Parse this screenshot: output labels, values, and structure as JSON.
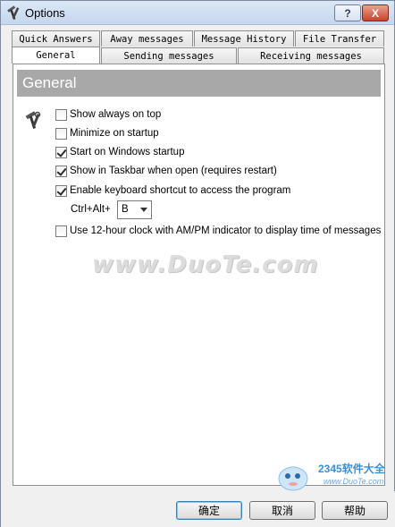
{
  "window": {
    "title": "Options"
  },
  "title_buttons": {
    "help": "?",
    "close": "X"
  },
  "tabs_row1": [
    "Quick Answers",
    "Away messages",
    "Message History",
    "File Transfer"
  ],
  "tabs_row2": [
    "General",
    "Sending messages",
    "Receiving messages"
  ],
  "active_tab": "General",
  "section": {
    "title": "General"
  },
  "options": [
    {
      "label": "Show always on top",
      "checked": false
    },
    {
      "label": "Minimize on startup",
      "checked": false
    },
    {
      "label": "Start on Windows startup",
      "checked": true
    },
    {
      "label": "Show in Taskbar when open (requires restart)",
      "checked": true
    },
    {
      "label": "Enable keyboard shortcut to access the program",
      "checked": true
    }
  ],
  "shortcut": {
    "label": "Ctrl+Alt+",
    "key": "B"
  },
  "clock_option": {
    "label": "Use 12-hour clock with AM/PM indicator to display time of messages",
    "checked": false
  },
  "watermark": "www.DuoTe.com",
  "corner_logo": {
    "brand": "2345软件大全",
    "url": "www.DuoTe.com"
  },
  "buttons": {
    "ok": "确定",
    "cancel": "取消",
    "help": "帮助"
  },
  "icons": [
    "tools-icon",
    "checkbox-icon",
    "dropdown-arrow-icon"
  ]
}
